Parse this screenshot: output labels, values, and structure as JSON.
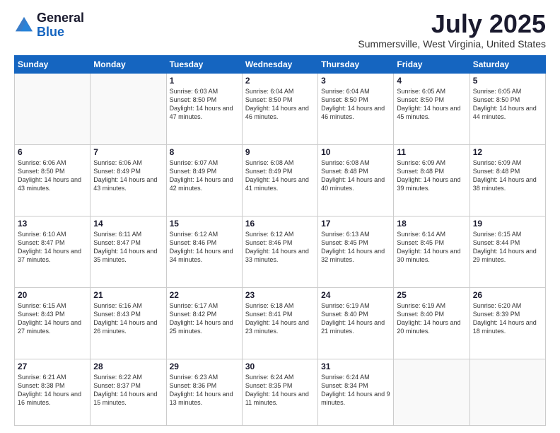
{
  "header": {
    "logo_line1": "General",
    "logo_line2": "Blue",
    "month": "July 2025",
    "location": "Summersville, West Virginia, United States"
  },
  "days_of_week": [
    "Sunday",
    "Monday",
    "Tuesday",
    "Wednesday",
    "Thursday",
    "Friday",
    "Saturday"
  ],
  "weeks": [
    [
      {
        "day": "",
        "empty": true
      },
      {
        "day": "",
        "empty": true
      },
      {
        "day": "1",
        "sunrise": "6:03 AM",
        "sunset": "8:50 PM",
        "daylight": "14 hours and 47 minutes."
      },
      {
        "day": "2",
        "sunrise": "6:04 AM",
        "sunset": "8:50 PM",
        "daylight": "14 hours and 46 minutes."
      },
      {
        "day": "3",
        "sunrise": "6:04 AM",
        "sunset": "8:50 PM",
        "daylight": "14 hours and 46 minutes."
      },
      {
        "day": "4",
        "sunrise": "6:05 AM",
        "sunset": "8:50 PM",
        "daylight": "14 hours and 45 minutes."
      },
      {
        "day": "5",
        "sunrise": "6:05 AM",
        "sunset": "8:50 PM",
        "daylight": "14 hours and 44 minutes."
      }
    ],
    [
      {
        "day": "6",
        "sunrise": "6:06 AM",
        "sunset": "8:50 PM",
        "daylight": "14 hours and 43 minutes."
      },
      {
        "day": "7",
        "sunrise": "6:06 AM",
        "sunset": "8:49 PM",
        "daylight": "14 hours and 43 minutes."
      },
      {
        "day": "8",
        "sunrise": "6:07 AM",
        "sunset": "8:49 PM",
        "daylight": "14 hours and 42 minutes."
      },
      {
        "day": "9",
        "sunrise": "6:08 AM",
        "sunset": "8:49 PM",
        "daylight": "14 hours and 41 minutes."
      },
      {
        "day": "10",
        "sunrise": "6:08 AM",
        "sunset": "8:48 PM",
        "daylight": "14 hours and 40 minutes."
      },
      {
        "day": "11",
        "sunrise": "6:09 AM",
        "sunset": "8:48 PM",
        "daylight": "14 hours and 39 minutes."
      },
      {
        "day": "12",
        "sunrise": "6:09 AM",
        "sunset": "8:48 PM",
        "daylight": "14 hours and 38 minutes."
      }
    ],
    [
      {
        "day": "13",
        "sunrise": "6:10 AM",
        "sunset": "8:47 PM",
        "daylight": "14 hours and 37 minutes."
      },
      {
        "day": "14",
        "sunrise": "6:11 AM",
        "sunset": "8:47 PM",
        "daylight": "14 hours and 35 minutes."
      },
      {
        "day": "15",
        "sunrise": "6:12 AM",
        "sunset": "8:46 PM",
        "daylight": "14 hours and 34 minutes."
      },
      {
        "day": "16",
        "sunrise": "6:12 AM",
        "sunset": "8:46 PM",
        "daylight": "14 hours and 33 minutes."
      },
      {
        "day": "17",
        "sunrise": "6:13 AM",
        "sunset": "8:45 PM",
        "daylight": "14 hours and 32 minutes."
      },
      {
        "day": "18",
        "sunrise": "6:14 AM",
        "sunset": "8:45 PM",
        "daylight": "14 hours and 30 minutes."
      },
      {
        "day": "19",
        "sunrise": "6:15 AM",
        "sunset": "8:44 PM",
        "daylight": "14 hours and 29 minutes."
      }
    ],
    [
      {
        "day": "20",
        "sunrise": "6:15 AM",
        "sunset": "8:43 PM",
        "daylight": "14 hours and 27 minutes."
      },
      {
        "day": "21",
        "sunrise": "6:16 AM",
        "sunset": "8:43 PM",
        "daylight": "14 hours and 26 minutes."
      },
      {
        "day": "22",
        "sunrise": "6:17 AM",
        "sunset": "8:42 PM",
        "daylight": "14 hours and 25 minutes."
      },
      {
        "day": "23",
        "sunrise": "6:18 AM",
        "sunset": "8:41 PM",
        "daylight": "14 hours and 23 minutes."
      },
      {
        "day": "24",
        "sunrise": "6:19 AM",
        "sunset": "8:40 PM",
        "daylight": "14 hours and 21 minutes."
      },
      {
        "day": "25",
        "sunrise": "6:19 AM",
        "sunset": "8:40 PM",
        "daylight": "14 hours and 20 minutes."
      },
      {
        "day": "26",
        "sunrise": "6:20 AM",
        "sunset": "8:39 PM",
        "daylight": "14 hours and 18 minutes."
      }
    ],
    [
      {
        "day": "27",
        "sunrise": "6:21 AM",
        "sunset": "8:38 PM",
        "daylight": "14 hours and 16 minutes."
      },
      {
        "day": "28",
        "sunrise": "6:22 AM",
        "sunset": "8:37 PM",
        "daylight": "14 hours and 15 minutes."
      },
      {
        "day": "29",
        "sunrise": "6:23 AM",
        "sunset": "8:36 PM",
        "daylight": "14 hours and 13 minutes."
      },
      {
        "day": "30",
        "sunrise": "6:24 AM",
        "sunset": "8:35 PM",
        "daylight": "14 hours and 11 minutes."
      },
      {
        "day": "31",
        "sunrise": "6:24 AM",
        "sunset": "8:34 PM",
        "daylight": "14 hours and 9 minutes."
      },
      {
        "day": "",
        "empty": true
      },
      {
        "day": "",
        "empty": true
      }
    ]
  ]
}
